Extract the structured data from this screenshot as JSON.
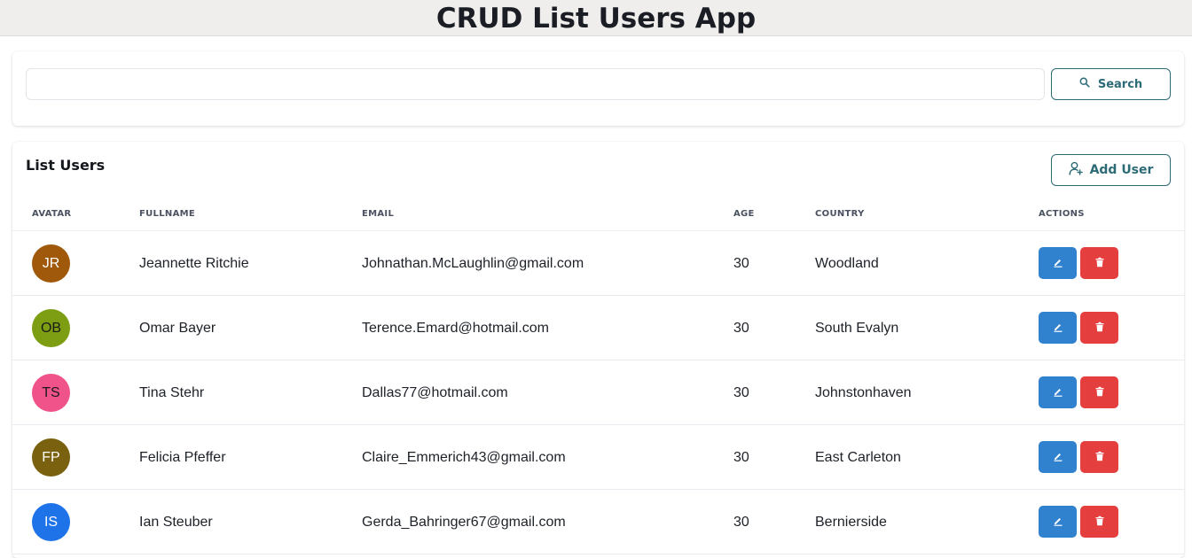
{
  "app": {
    "title": "CRUD List Users App"
  },
  "search": {
    "placeholder": "",
    "value": "",
    "button_label": "Search",
    "button_icon": "search-icon"
  },
  "list": {
    "title": "List Users",
    "add_button_label": "Add User",
    "add_button_icon": "user-plus-icon",
    "columns": [
      "AVATAR",
      "FULLNAME",
      "EMAIL",
      "AGE",
      "COUNTRY",
      "ACTIONS"
    ],
    "rows": [
      {
        "initials": "JR",
        "avatar_bg": "#a0580b",
        "avatar_fg": "#ffffff",
        "fullname": "Jeannette Ritchie",
        "email": "Johnathan.McLaughlin@gmail.com",
        "age": "30",
        "country": "Woodland"
      },
      {
        "initials": "OB",
        "avatar_bg": "#7d9e13",
        "avatar_fg": "#1a1a1a",
        "fullname": "Omar Bayer",
        "email": "Terence.Emard@hotmail.com",
        "age": "30",
        "country": "South Evalyn"
      },
      {
        "initials": "TS",
        "avatar_bg": "#f0538a",
        "avatar_fg": "#1a1a1a",
        "fullname": "Tina Stehr",
        "email": "Dallas77@hotmail.com",
        "age": "30",
        "country": "Johnstonhaven"
      },
      {
        "initials": "FP",
        "avatar_bg": "#7a6110",
        "avatar_fg": "#ffffff",
        "fullname": "Felicia Pfeffer",
        "email": "Claire_Emmerich43@gmail.com",
        "age": "30",
        "country": "East Carleton"
      },
      {
        "initials": "IS",
        "avatar_bg": "#1e73e8",
        "avatar_fg": "#ffffff",
        "fullname": "Ian Steuber",
        "email": "Gerda_Bahringer67@gmail.com",
        "age": "30",
        "country": "Bernierside"
      }
    ],
    "edit_icon": "pencil-icon",
    "delete_icon": "trash-icon"
  },
  "colors": {
    "accent": "#2c6b76",
    "edit": "#3182ce",
    "delete": "#e53e3e",
    "header_bg": "#efeeec"
  }
}
